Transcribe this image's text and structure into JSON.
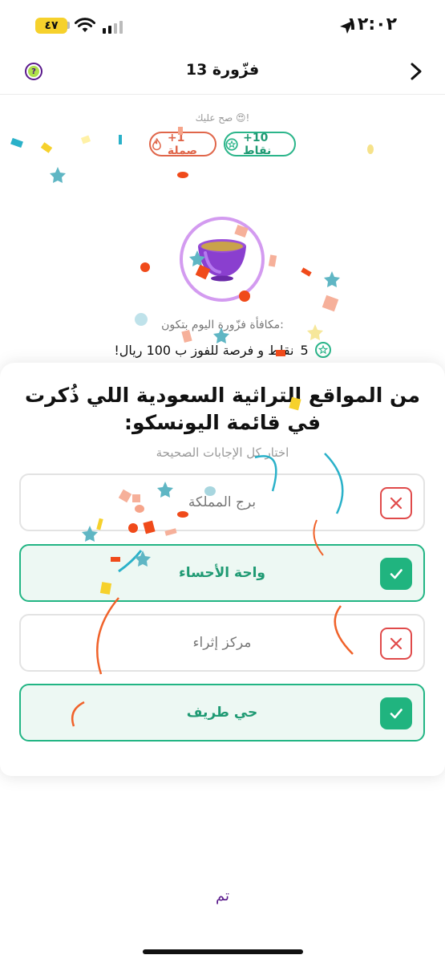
{
  "status_bar": {
    "time": "١٢:٠٢",
    "battery": "٤٧"
  },
  "header": {
    "title": "فزّورة 13",
    "help_icon": "question-circle-icon",
    "back_icon": "chevron-right-icon"
  },
  "result": {
    "praise": "صح عليك 😍!",
    "points_chip": "+10 نقاط",
    "streak_chip": "+1 صملة"
  },
  "reward": {
    "label": "مكافأة فزّورة اليوم بتكون:",
    "points_value": "5",
    "description": "نقاط و فرصة للفوز ب 100 ريال!"
  },
  "quiz": {
    "question": "من المواقع التراثية السعودية اللي ذُكرت في قائمة اليونسكو:",
    "instruction": "اختار كل الإجابات الصحيحة",
    "options": [
      {
        "label": "برج المملكة",
        "state": "wrong"
      },
      {
        "label": "واحة الأحساء",
        "state": "correct"
      },
      {
        "label": "مركز إثراء",
        "state": "wrong"
      },
      {
        "label": "حي طريف",
        "state": "correct"
      }
    ]
  },
  "footer": {
    "done_label": "تم"
  },
  "colors": {
    "correct": "#22b584",
    "wrong": "#e04a4a",
    "brand_purple": "#5a1a8c",
    "streak": "#e0664a"
  }
}
